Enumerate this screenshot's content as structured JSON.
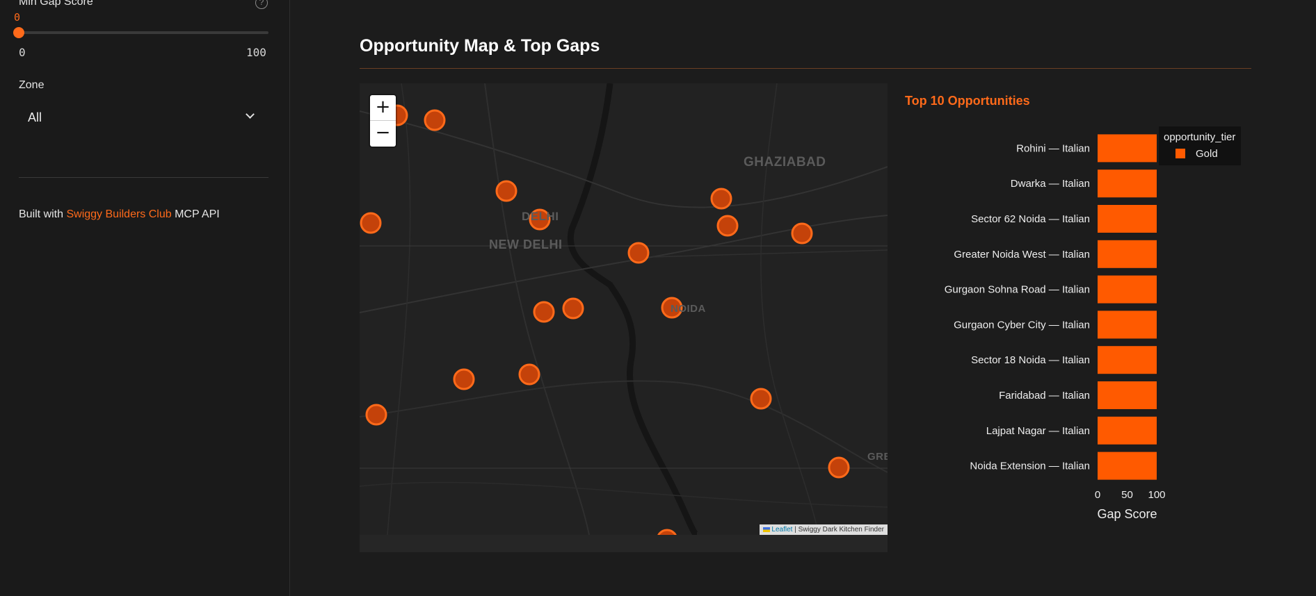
{
  "sidebar": {
    "slider": {
      "label": "Min Gap Score",
      "value": "0",
      "min_label": "0",
      "max_label": "100",
      "help_icon": "?",
      "fraction": 0.0
    },
    "zone": {
      "label": "Zone",
      "value": "All"
    },
    "footer": {
      "prefix": "Built with ",
      "link": "Swiggy Builders Club",
      "suffix": " MCP API"
    }
  },
  "main": {
    "title": "Opportunity Map & Top Gaps"
  },
  "map": {
    "zoom_in": "+",
    "zoom_out": "−",
    "labels": [
      "GHAZIABAD",
      "DELHI",
      "NEW DELHI",
      "NOIDA",
      "GRE"
    ],
    "attribution": {
      "leaflet": "Leaflet",
      "rest": " | Swiggy Dark Kitchen Finder"
    },
    "marker_color": "#c4420a",
    "marker_stroke": "#ff6a1a"
  },
  "colors": {
    "accent": "#ff6a1a",
    "bar": "#ff5a00"
  },
  "chart_data": {
    "type": "bar",
    "orientation": "horizontal",
    "title": "Top 10 Opportunities",
    "categories": [
      "Rohini — Italian",
      "Dwarka — Italian",
      "Sector 62 Noida — Italian",
      "Greater Noida West — Italian",
      "Gurgaon Sohna Road — Italian",
      "Gurgaon Cyber City — Italian",
      "Sector 18 Noida — Italian",
      "Faridabad — Italian",
      "Lajpat Nagar — Italian",
      "Noida Extension — Italian"
    ],
    "series": [
      {
        "name": "Gold",
        "values": [
          100,
          100,
          100,
          100,
          100,
          100,
          100,
          100,
          100,
          100
        ]
      }
    ],
    "xlabel": "Gap Score",
    "xticks": [
      "0",
      "50",
      "100"
    ],
    "xlim": [
      0,
      100
    ],
    "legend": {
      "title": "opportunity_tier",
      "placement": "top-right"
    }
  }
}
